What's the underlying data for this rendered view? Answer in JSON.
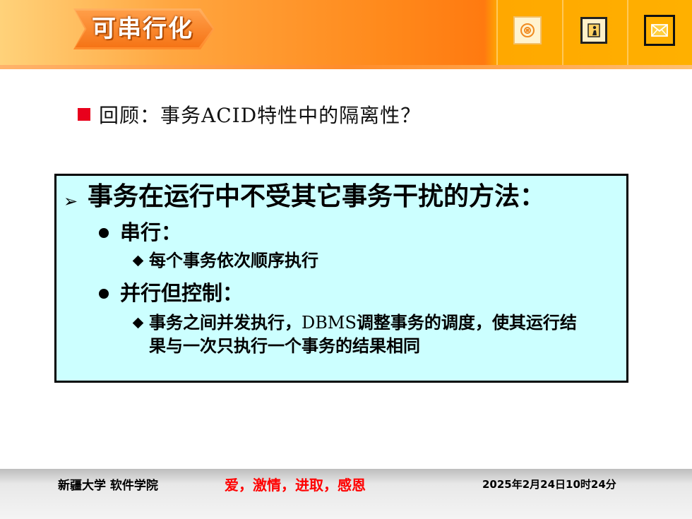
{
  "header": {
    "title": "可串行化",
    "nav": [
      {
        "name": "home-icon"
      },
      {
        "name": "exit-icon"
      },
      {
        "name": "mail-icon"
      }
    ]
  },
  "content": {
    "review": "回顾：事务ACID特性中的隔离性？",
    "box": {
      "heading": "事务在运行中不受其它事务干扰的方法：",
      "serial_title": "串行：",
      "serial_detail": "每个事务依次顺序执行",
      "parallel_title": "并行但控制：",
      "parallel_detail_a": "事务之间并发执行，",
      "parallel_detail_dbms": "DBMS",
      "parallel_detail_b": "调整事务的调度，使其运行结",
      "parallel_detail_c": "果与一次只执行一个事务的结果相同"
    }
  },
  "footer": {
    "org": "新疆大学 软件学院",
    "motto": "爱，激情，进取，感恩",
    "date": "2025年2月24日10时24分"
  },
  "colors": {
    "accent": "#ff8a1c",
    "box_bg": "#ccffff",
    "bullet": "#e8001c",
    "motto": "#ff0000"
  }
}
